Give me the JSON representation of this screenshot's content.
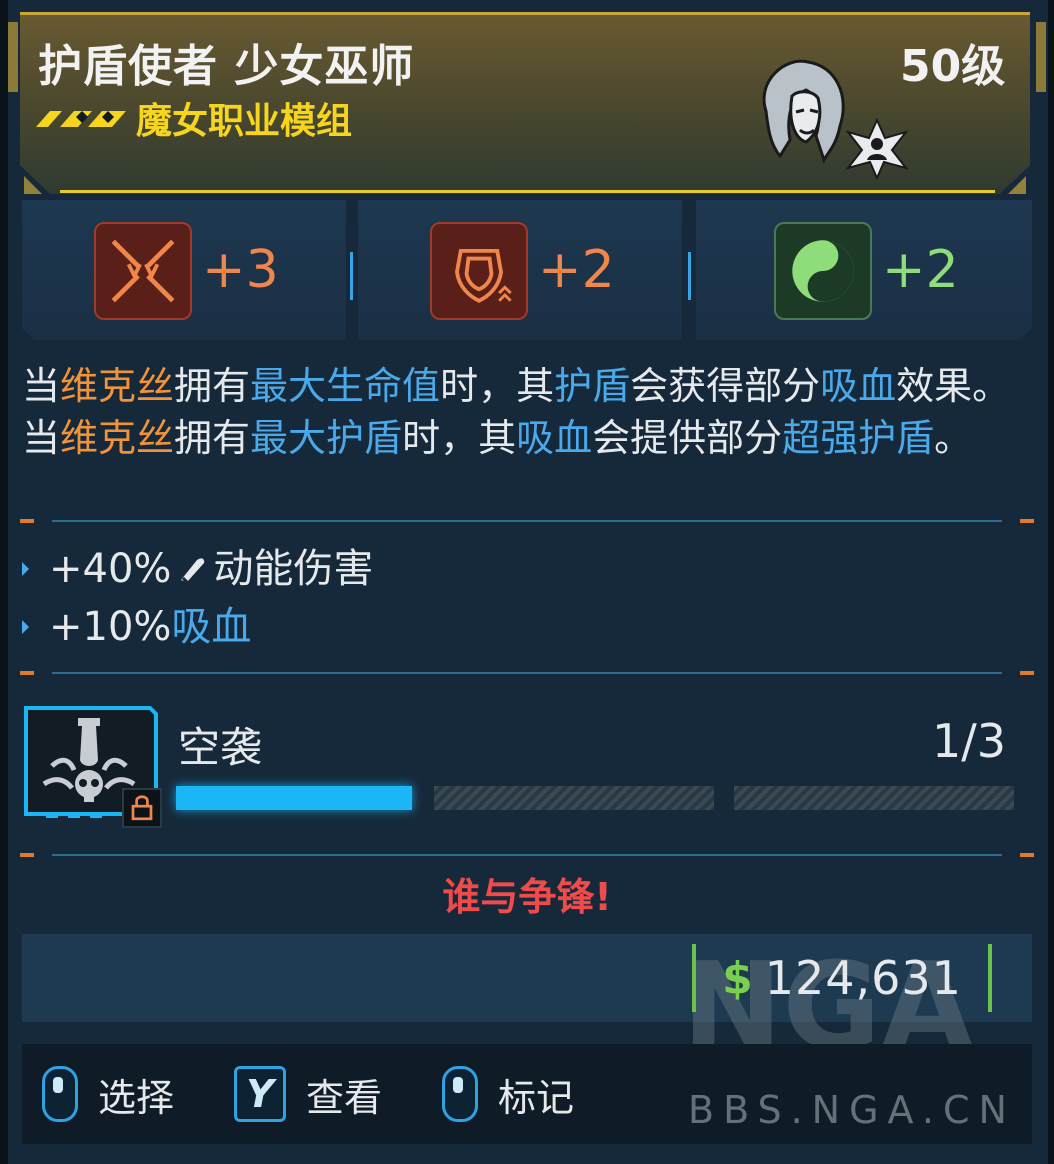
{
  "card": {
    "title": "护盾使者 少女巫师",
    "level": "50级",
    "subtitle": "魔女职业模组",
    "colors": {
      "gold": "#f5d51e",
      "orange": "#f2933a",
      "blue": "#4aa9ea",
      "green": "#8fdc7a",
      "red": "#f04a4a"
    }
  },
  "stats": [
    {
      "icon": "fangs-skill-icon",
      "value": "+3"
    },
    {
      "icon": "shield-skill-icon",
      "value": "+2"
    },
    {
      "icon": "yin-yang-gun-skill-icon",
      "value": "+2"
    }
  ],
  "description": {
    "p1": "当",
    "p2": "维克丝",
    "p3": "拥有",
    "p4": "最大生命值",
    "p5": "时，其",
    "p6": "护盾",
    "p7": "会获得部分",
    "p8": "吸血",
    "p9": "效果。当",
    "p10": "维克丝",
    "p11": "拥有",
    "p12": "最大护盾",
    "p13": "时，其",
    "p14": "吸血",
    "p15": "会提供部分",
    "p16": "超强护盾",
    "p17": "。"
  },
  "bonuses": [
    {
      "value": "+40%",
      "label": "动能伤害",
      "icon": "bullet-icon"
    },
    {
      "value": "+10%",
      "label": "吸血"
    }
  ],
  "skill": {
    "name": "空袭",
    "count": "1/3",
    "progress": 0.333,
    "icon": "airstrike-bomb-skull-icon"
  },
  "tagline": "谁与争锋!",
  "price": {
    "symbol": "$",
    "amount": "124,631"
  },
  "footer": {
    "select": "选择",
    "inspect_key": "Y",
    "inspect": "查看",
    "mark": "标记"
  },
  "watermark": {
    "logo": "NGA",
    "text": "BBS.NGA.CN"
  }
}
